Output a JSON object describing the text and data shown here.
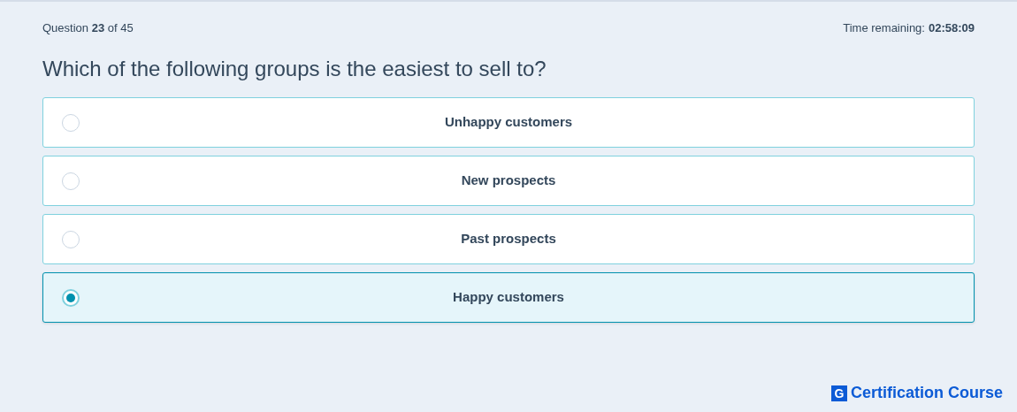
{
  "header": {
    "progress": "Question **23** of 45",
    "timer_label": "Time remaining:",
    "timer_value": "02:58:09"
  },
  "question": "Which of the following groups is the easiest to sell to?",
  "options": [
    {
      "label": "Unhappy customers",
      "selected": false
    },
    {
      "label": "New prospects",
      "selected": false
    },
    {
      "label": "Past prospects",
      "selected": false
    },
    {
      "label": "Happy customers",
      "selected": true
    }
  ],
  "footer": {
    "logo_letter": "G",
    "brand": "Certification Course"
  }
}
